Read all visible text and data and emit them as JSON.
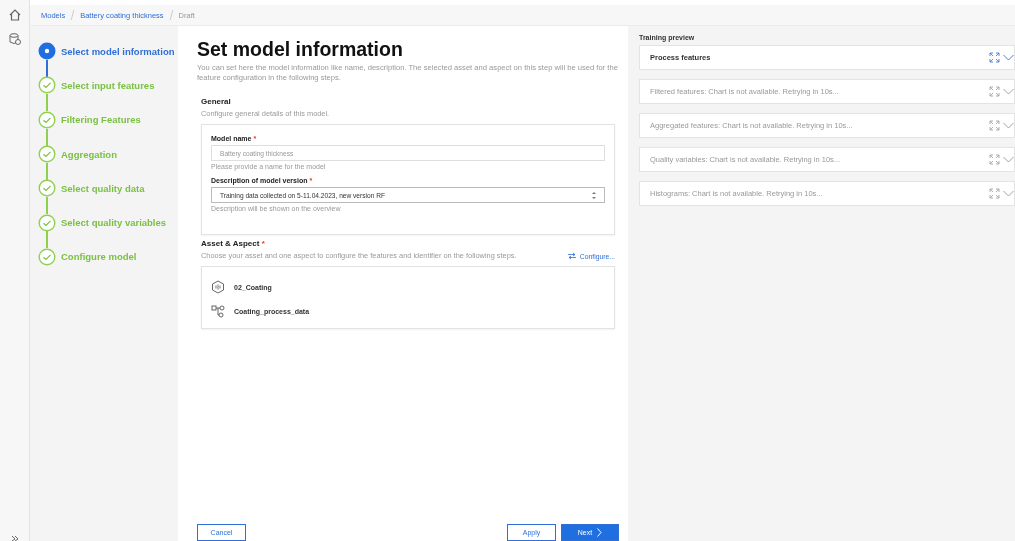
{
  "breadcrumb": [
    {
      "label": "Models",
      "kind": "link"
    },
    {
      "label": "Battery coating thickness",
      "kind": "link"
    },
    {
      "label": "Draft",
      "kind": "current"
    }
  ],
  "steps": [
    {
      "label": "Select model information",
      "selected": true,
      "completed": false
    },
    {
      "label": "Select input features",
      "selected": false,
      "completed": true
    },
    {
      "label": "Filtering Features",
      "selected": false,
      "completed": true
    },
    {
      "label": "Aggregation",
      "selected": false,
      "completed": true
    },
    {
      "label": "Select quality data",
      "selected": false,
      "completed": true
    },
    {
      "label": "Select quality variables",
      "selected": false,
      "completed": true
    },
    {
      "label": "Configure model",
      "selected": false,
      "completed": true
    }
  ],
  "page": {
    "title": "Set model information",
    "description": "You can set here the model information like name, description. The selected asset and aspect on this step will be used for the feature configuration in the following steps."
  },
  "general": {
    "title": "General",
    "subtitle": "Configure general details of this model.",
    "fields": [
      {
        "label": "Model name",
        "required_mark": "*",
        "kind": "input",
        "placeholder": "Battery coating thickness",
        "hint": "Please provide a name for the model"
      },
      {
        "label": "Description of model version",
        "required_mark": "*",
        "kind": "textarea",
        "value": "Training data collected on 5-11.04.2023, new version RF",
        "hint": "Description will be shown on the overview"
      }
    ]
  },
  "asset": {
    "title": "Asset & Aspect",
    "required_mark": "*",
    "subtitle": "Choose your asset and one aspect to configure the features and identifier on the following steps.",
    "configure": "Configure...",
    "items": [
      {
        "label": "02_Coating",
        "kind": "asset"
      },
      {
        "label": "Coating_process_data",
        "kind": "aspect"
      }
    ]
  },
  "buttons": [
    {
      "label": "Cancel",
      "kind": "secondary"
    },
    {
      "label": "Apply",
      "kind": "secondary"
    },
    {
      "label": "Next",
      "kind": "primary"
    }
  ],
  "preview": {
    "title": "Training preview",
    "cards": [
      {
        "label": "Process features",
        "available": true
      },
      {
        "label": "Filtered features: Chart is not available. Retrying in 10s...",
        "available": false
      },
      {
        "label": "Aggregated features: Chart is not available. Retrying in 10s...",
        "available": false
      },
      {
        "label": "Quality variables: Chart is not available. Retrying in 10s...",
        "available": false
      },
      {
        "label": "Histograms: Chart is not available. Retrying in 10s...",
        "available": false
      }
    ]
  }
}
